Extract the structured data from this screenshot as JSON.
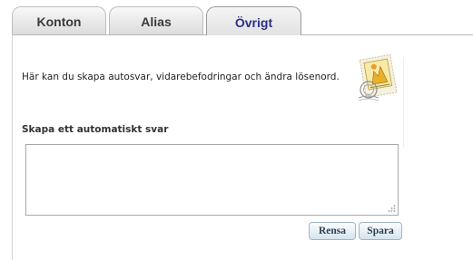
{
  "tabs": [
    {
      "label": "Konton",
      "active": false
    },
    {
      "label": "Alias",
      "active": false
    },
    {
      "label": "Övrigt",
      "active": true
    }
  ],
  "panel": {
    "intro_text": "Här kan du skapa autosvar, vidarebefodringar och ändra lösenord.",
    "stamp_icon": "postage-stamp-icon",
    "auto_reply": {
      "title": "Skapa ett automatiskt svar",
      "value": ""
    },
    "buttons": {
      "clear_label": "Rensa",
      "save_label": "Spara"
    }
  },
  "colors": {
    "active_tab_text": "#2e2e8a",
    "button_text": "#2c3f55",
    "button_border": "#9fb5c6"
  }
}
